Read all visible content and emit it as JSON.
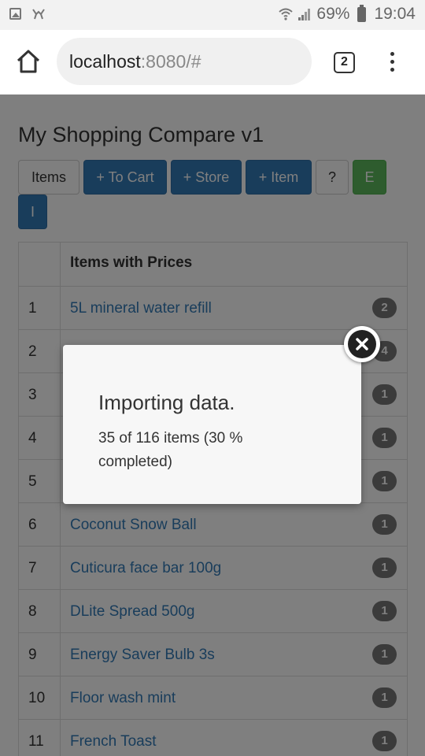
{
  "status_bar": {
    "left_icons": [
      "image-icon",
      "app-notification-icon"
    ],
    "right_icons": [
      "wifi-icon",
      "signal-icon"
    ],
    "battery": "69%",
    "time": "19:04"
  },
  "browser": {
    "url_host": "localhost",
    "url_rest": ":8080/#",
    "tab_count": "2"
  },
  "app": {
    "title": "My Shopping Compare v1",
    "toolbar": {
      "items": "Items",
      "to_cart": "+ To Cart",
      "store": "+ Store",
      "item": "+ Item",
      "help": "?",
      "export": "E",
      "import": "I"
    },
    "table": {
      "header": "Items with Prices",
      "rows": [
        {
          "num": "1",
          "name": "5L mineral water refill",
          "count": "2"
        },
        {
          "num": "2",
          "name": "",
          "count": "4"
        },
        {
          "num": "3",
          "name": "",
          "count": "1"
        },
        {
          "num": "4",
          "name": "",
          "count": "1"
        },
        {
          "num": "5",
          "name": "",
          "count": "1"
        },
        {
          "num": "6",
          "name": "Coconut Snow Ball",
          "count": "1"
        },
        {
          "num": "7",
          "name": "Cuticura face bar 100g",
          "count": "1"
        },
        {
          "num": "8",
          "name": "DLite Spread 500g",
          "count": "1"
        },
        {
          "num": "9",
          "name": "Energy Saver Bulb 3s",
          "count": "1"
        },
        {
          "num": "10",
          "name": "Floor wash mint",
          "count": "1"
        },
        {
          "num": "11",
          "name": "French Toast",
          "count": "1"
        }
      ]
    }
  },
  "modal": {
    "title": "Importing data.",
    "body": "35 of 116 items (30 % completed)",
    "close_icon": "close-icon"
  },
  "colors": {
    "primary": "#337ab7",
    "success": "#5cb85c",
    "badge": "#777777"
  }
}
